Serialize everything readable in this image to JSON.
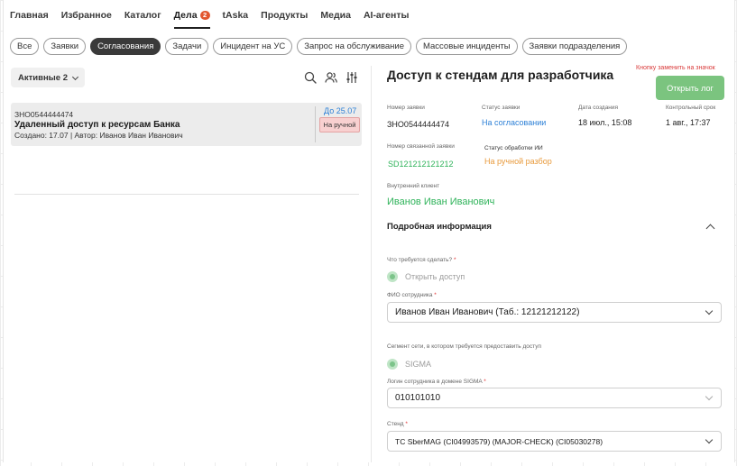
{
  "nav": {
    "items": [
      "Главная",
      "Избранное",
      "Каталог",
      "Дела",
      "tAska",
      "Продукты",
      "Медиа",
      "AI-агенты"
    ],
    "badge": "2"
  },
  "filters": [
    "Все",
    "Заявки",
    "Согласования",
    "Задачи",
    "Инцидент на УС",
    "Запрос на обслуживание",
    "Массовые инциденты",
    "Заявки подразделения"
  ],
  "left": {
    "select_label": "Активные 2",
    "card": {
      "number": "ЗНО0544444474",
      "title": "Удаленный доступ к ресурсам Банка",
      "meta": "Создано: 17.07 | Автор: Иванов Иван Иванович",
      "due": "До 25.07",
      "status": "На ручной"
    }
  },
  "detail": {
    "title": "Доступ к стендам для разработчика",
    "hint": "Кнопку заменить на значок",
    "open_button": "Открыть лог",
    "request_number_label": "Номер заявки",
    "request_number": "ЗНО0544444474",
    "status_label": "Статус заявки",
    "status": "На согласовании",
    "created_label": "Дата создания",
    "created": "18 июл., 15:08",
    "deadline_label": "Контрольный срок",
    "deadline": "1 авг., 17:37",
    "linked_label": "Номер связанной заявки",
    "linked": "SD121212121212",
    "ai_status_label": "Статус обработки ИИ",
    "ai_status": "На ручной разбор",
    "client_label": "Внутренний клиент",
    "client": "Иванов Иван Иванович",
    "section_title": "Подробная информация",
    "q_action_label": "Что требуется сделать?",
    "q_action_value": "Открыть доступ",
    "employee_label": "ФИО сотрудника",
    "employee_value": "Иванов Иван Иванович (Таб.: 12121212122)",
    "segment_label": "Сегмент сети, в котором требуется предоставить доступ",
    "segment_value": "SIGMA",
    "login_label": "Логин сотрудника в домене SIGMA",
    "login_value": "010101010",
    "stand_label": "Стенд",
    "stand_value": "TC SberMAG (CI04993579) (MAJOR-CHECK) (CI05030278)",
    "required_mark": "*"
  },
  "colors": {
    "accent_green": "#7bc47f",
    "link_blue": "#2b7fd6",
    "status_pink": "#f8d0d0",
    "badge_orange": "#e2572f"
  }
}
